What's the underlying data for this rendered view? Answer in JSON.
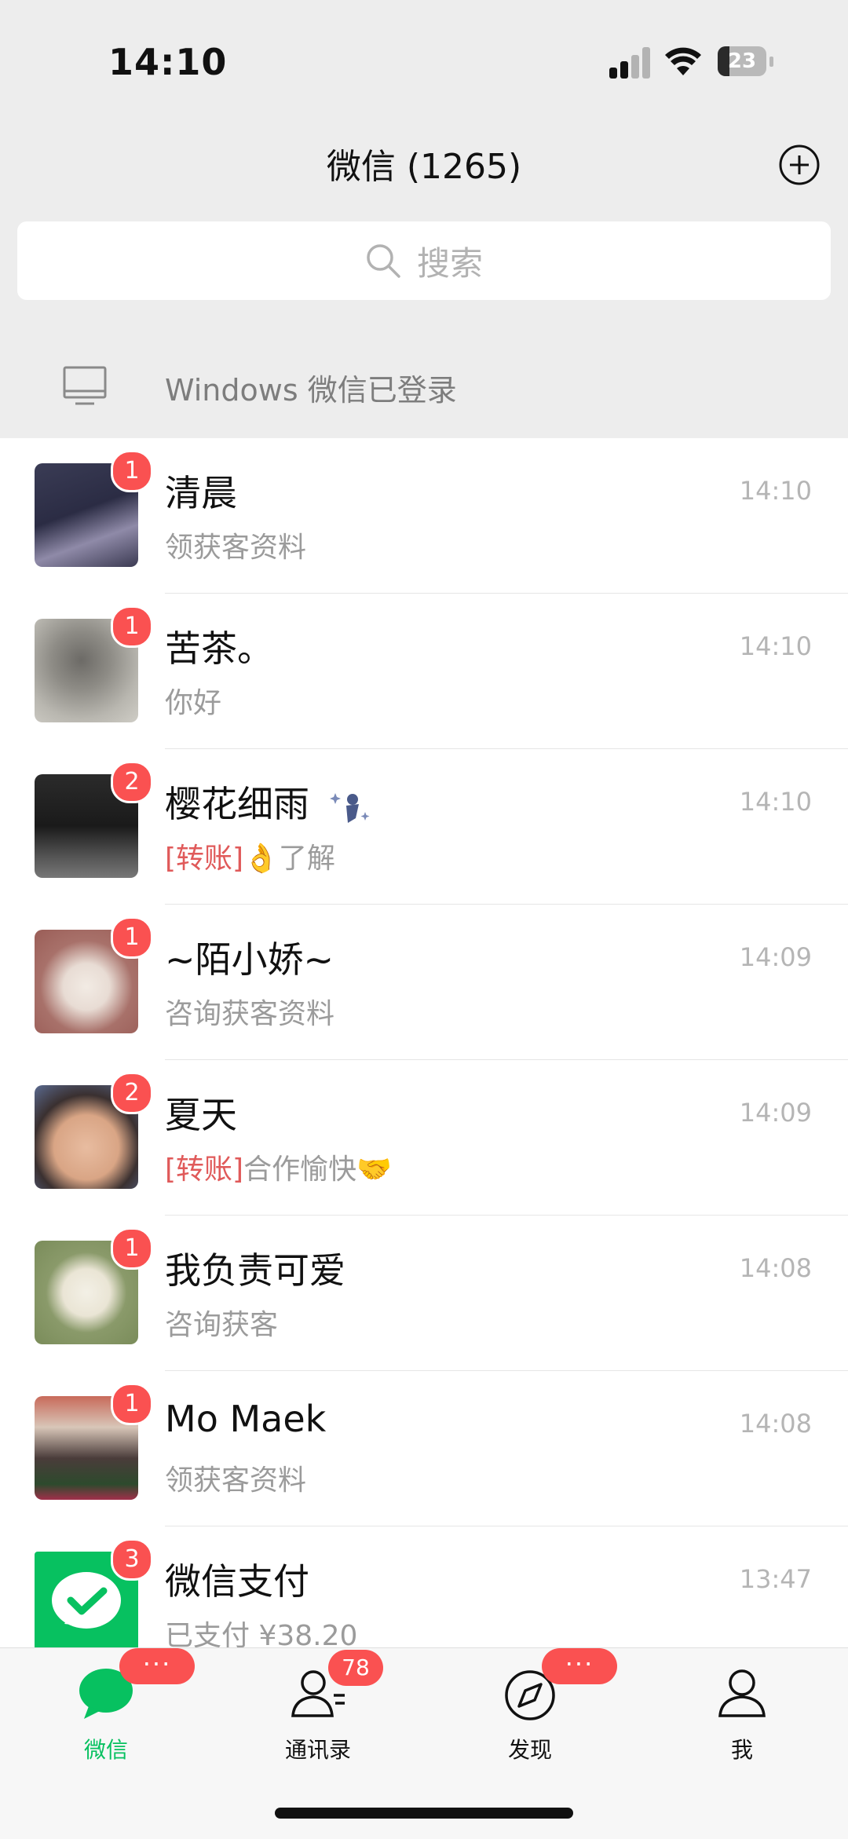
{
  "status_bar": {
    "time": "14:10",
    "battery": "23"
  },
  "nav": {
    "title": "微信 (1265)"
  },
  "search": {
    "placeholder": "搜索"
  },
  "windows_login": {
    "text": "Windows 微信已登录"
  },
  "chats": [
    {
      "name": "清晨",
      "time": "14:10",
      "badge": "1",
      "message": "领获客资料"
    },
    {
      "name": "苦茶。",
      "time": "14:10",
      "badge": "1",
      "message": "你好"
    },
    {
      "name": "樱花细雨",
      "time": "14:10",
      "badge": "2",
      "message_prefix": "[转账]",
      "message": "了解",
      "emoji": "👌"
    },
    {
      "name": "~陌小娇~",
      "time": "14:09",
      "badge": "1",
      "message": "咨询获客资料"
    },
    {
      "name": "夏天",
      "time": "14:09",
      "badge": "2",
      "message_prefix": "[转账]",
      "message": "合作愉快",
      "emoji": "🤝"
    },
    {
      "name": "我负责可爱",
      "time": "14:08",
      "badge": "1",
      "message": "咨询获客"
    },
    {
      "name": "Mo Maek",
      "time": "14:08",
      "badge": "1",
      "message": "领获客资料"
    },
    {
      "name": "微信支付",
      "time": "13:47",
      "badge": "3",
      "message": "已支付 ¥38.20"
    }
  ],
  "tabs": [
    {
      "label": "微信",
      "badge": "···",
      "active": true
    },
    {
      "label": "通讯录",
      "badge": "78"
    },
    {
      "label": "发现",
      "badge": "···"
    },
    {
      "label": "我"
    }
  ],
  "colors": {
    "accent": "#07c160",
    "badge": "#fa5151",
    "transfer": "#e05a5a"
  }
}
